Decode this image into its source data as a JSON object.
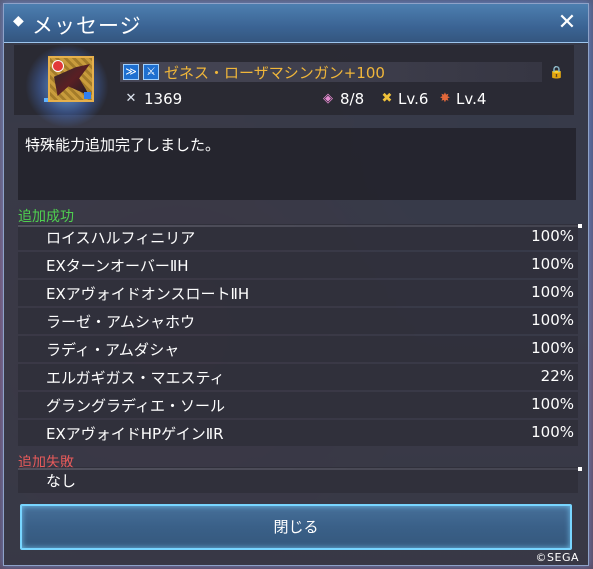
{
  "dialog": {
    "title": "メッセージ",
    "close_glyph": "✕"
  },
  "item": {
    "name": "ゼネス・ローザマシンガン+100",
    "attack": "1369",
    "slots": "8/8",
    "level_a": "Lv.6",
    "level_b": "Lv.4"
  },
  "message": "特殊能力追加完了しました。",
  "success": {
    "label": "追加成功",
    "label_color": "#4fd04f",
    "abilities": [
      {
        "name": "ロイスハルフィニリア",
        "rate": "100%"
      },
      {
        "name": "EXターンオーバーⅡH",
        "rate": "100%"
      },
      {
        "name": "EXアヴォイドオンスロートⅡH",
        "rate": "100%"
      },
      {
        "name": "ラーゼ・アムシャホウ",
        "rate": "100%"
      },
      {
        "name": "ラディ・アムダシャ",
        "rate": "100%"
      },
      {
        "name": "エルガギガス・マエスティ",
        "rate": "22%"
      },
      {
        "name": "グラングラディエ・ソール",
        "rate": "100%"
      },
      {
        "name": "EXアヴォイドHPゲインⅡR",
        "rate": "100%"
      }
    ]
  },
  "failure": {
    "label": "追加失敗",
    "label_color": "#e65a5a",
    "items": [
      "なし"
    ]
  },
  "buttons": {
    "close_label": "閉じる"
  },
  "footer": {
    "copyright": "©SEGA"
  }
}
